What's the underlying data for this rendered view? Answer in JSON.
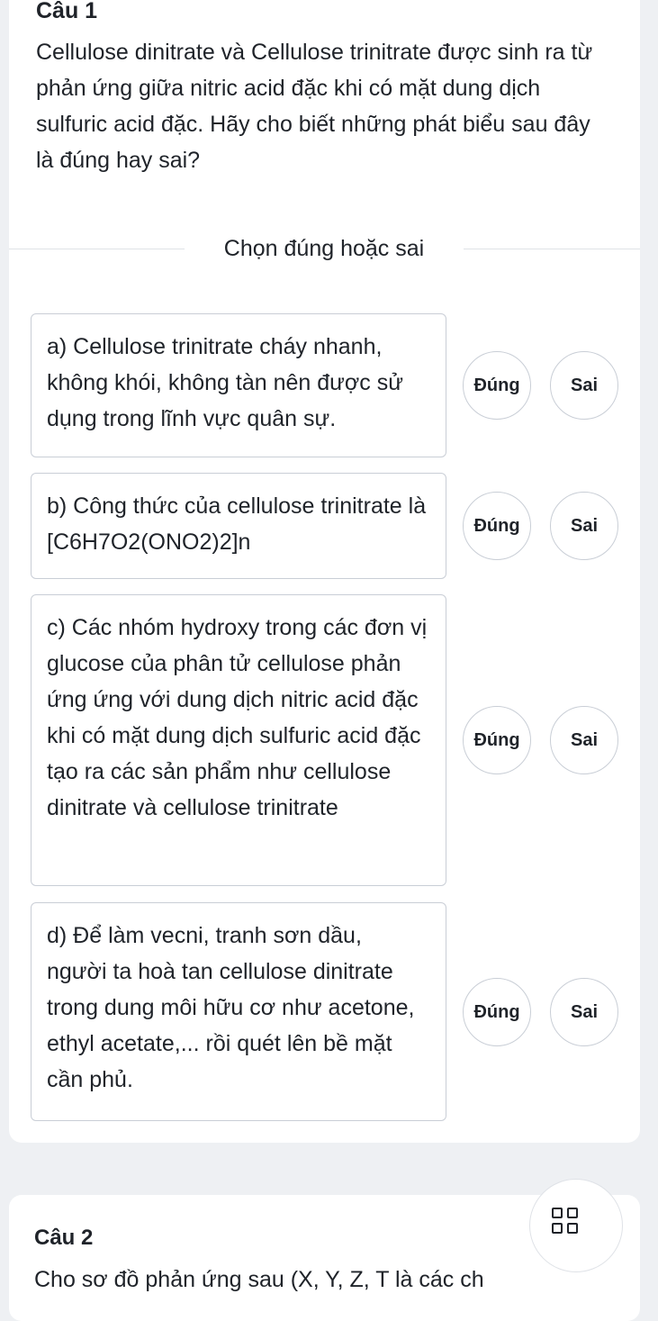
{
  "question1": {
    "title": "Câu 1",
    "text": "Cellulose dinitrate và Cellulose trinitrate được sinh ra từ phản ứng giữa nitric acid đặc khi có mặt dung dịch sulfuric acid đặc. Hãy cho biết những phát biểu sau đây là đúng hay sai?",
    "instruction": "Chọn đúng hoặc sai",
    "statements": [
      {
        "text": "a) Cellulose trinitrate cháy nhanh, không khói, không tàn nên được sử dụng trong lĩnh vực quân sự.",
        "true_label": "Đúng",
        "false_label": "Sai"
      },
      {
        "text": "b) Công thức của cellulose trinitrate là [C6H7O2(ONO2)2]n",
        "true_label": "Đúng",
        "false_label": "Sai"
      },
      {
        "text": "c) Các nhóm hydroxy trong các đơn vị glucose của phân tử cellulose phản ứng ứng với dung dịch nitric acid đặc khi có mặt dung dịch sulfuric acid đặc tạo ra các sản phẩm như cellulose dinitrate và cellulose trinitrate",
        "true_label": "Đúng",
        "false_label": "Sai"
      },
      {
        "text": "d) Để làm vecni, tranh sơn dầu, người ta hoà tan cellulose dinitrate trong dung môi hữu cơ như acetone, ethyl acetate,... rồi quét lên bề mặt cần phủ.",
        "true_label": "Đúng",
        "false_label": "Sai"
      }
    ]
  },
  "question2": {
    "title": "Câu 2",
    "text": "Cho sơ đồ phản ứng sau (X, Y, Z, T là các ch",
    "menu_icon": "grid-icon"
  }
}
